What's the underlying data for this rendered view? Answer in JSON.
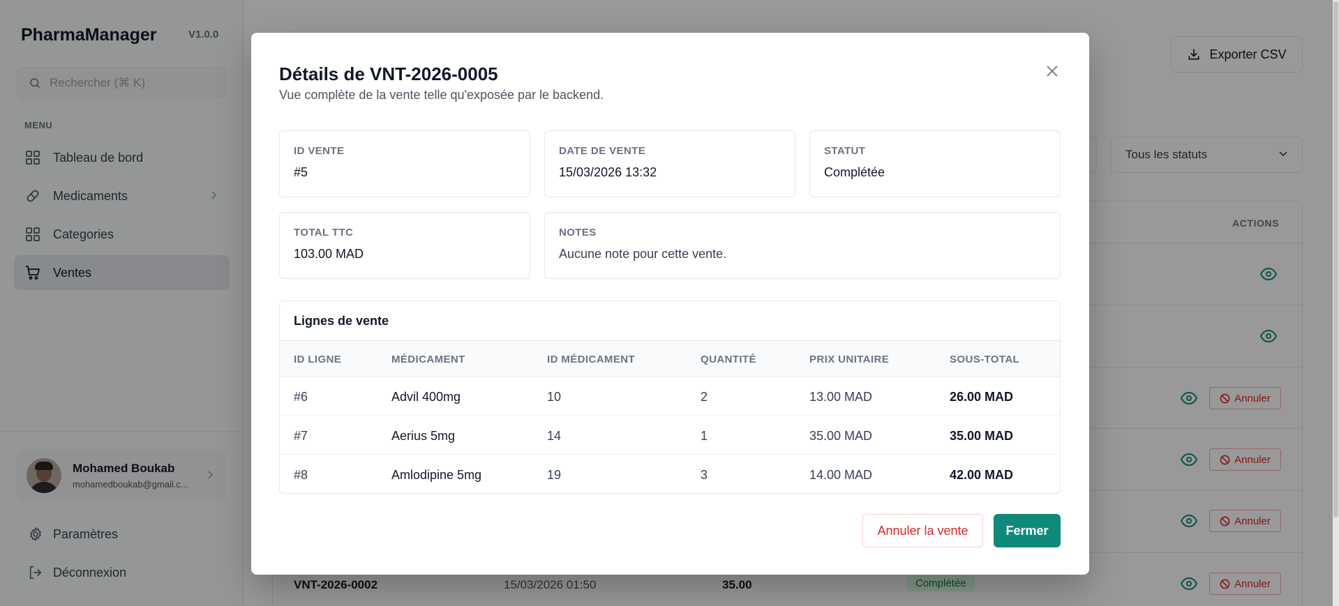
{
  "app": {
    "name": "PharmaManager",
    "version": "V1.0.0"
  },
  "sidebar": {
    "search_placeholder": "Rechercher (⌘ K)",
    "menu_title": "MENU",
    "items": [
      {
        "label": "Tableau de bord",
        "icon": "grid-icon"
      },
      {
        "label": "Medicaments",
        "icon": "pill-icon"
      },
      {
        "label": "Categories",
        "icon": "grid-icon"
      },
      {
        "label": "Ventes",
        "icon": "cart-icon",
        "active": true
      }
    ],
    "user": {
      "name": "Mohamed Boukab",
      "email": "mohamedboukab@gmail.c..."
    },
    "settings_label": "Paramètres",
    "logout_label": "Déconnexion"
  },
  "main": {
    "export_label": "Exporter CSV",
    "status_filter": "Tous les statuts",
    "actions_header": "ACTIONS",
    "cancel_label": "Annuler",
    "visible_row": {
      "reference": "VNT-2026-0002",
      "date": "15/03/2026 01:50",
      "total": "35.00",
      "status": "Complétée"
    }
  },
  "modal": {
    "title": "Détails de VNT-2026-0005",
    "subtitle": "Vue complète de la vente telle qu'exposée par le backend.",
    "fields": {
      "id_label": "ID VENTE",
      "id_value": "#5",
      "date_label": "DATE DE VENTE",
      "date_value": "15/03/2026 13:32",
      "status_label": "STATUT",
      "status_value": "Complétée",
      "total_label": "TOTAL TTC",
      "total_value": "103.00 MAD",
      "notes_label": "NOTES",
      "notes_value": "Aucune note pour cette vente."
    },
    "lines": {
      "title": "Lignes de vente",
      "headers": [
        "ID LIGNE",
        "MÉDICAMENT",
        "ID MÉDICAMENT",
        "QUANTITÉ",
        "PRIX UNITAIRE",
        "SOUS-TOTAL"
      ],
      "rows": [
        [
          "#6",
          "Advil 400mg",
          "10",
          "2",
          "13.00 MAD",
          "26.00 MAD"
        ],
        [
          "#7",
          "Aerius 5mg",
          "14",
          "1",
          "35.00 MAD",
          "35.00 MAD"
        ],
        [
          "#8",
          "Amlodipine 5mg",
          "19",
          "3",
          "14.00 MAD",
          "42.00 MAD"
        ]
      ]
    },
    "cancel_sale_label": "Annuler la vente",
    "close_label": "Fermer"
  },
  "colors": {
    "accent": "#0f8a7a",
    "danger": "#dc2626",
    "badge_bg": "#dcfce7"
  }
}
